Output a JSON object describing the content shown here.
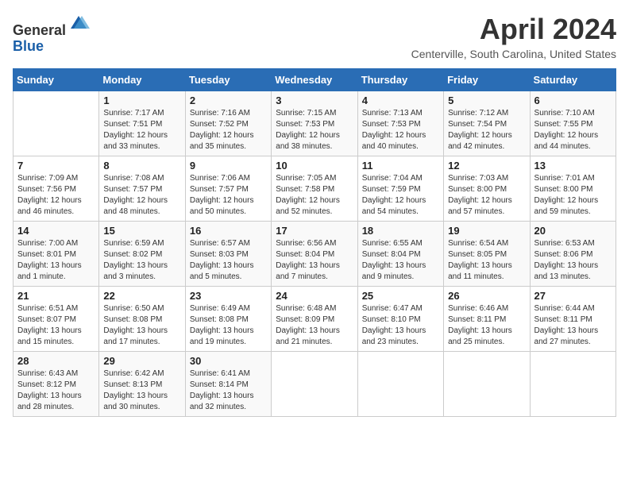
{
  "header": {
    "logo_line1": "General",
    "logo_line2": "Blue",
    "month": "April 2024",
    "location": "Centerville, South Carolina, United States"
  },
  "days_of_week": [
    "Sunday",
    "Monday",
    "Tuesday",
    "Wednesday",
    "Thursday",
    "Friday",
    "Saturday"
  ],
  "weeks": [
    [
      {
        "num": "",
        "info": ""
      },
      {
        "num": "1",
        "info": "Sunrise: 7:17 AM\nSunset: 7:51 PM\nDaylight: 12 hours\nand 33 minutes."
      },
      {
        "num": "2",
        "info": "Sunrise: 7:16 AM\nSunset: 7:52 PM\nDaylight: 12 hours\nand 35 minutes."
      },
      {
        "num": "3",
        "info": "Sunrise: 7:15 AM\nSunset: 7:53 PM\nDaylight: 12 hours\nand 38 minutes."
      },
      {
        "num": "4",
        "info": "Sunrise: 7:13 AM\nSunset: 7:53 PM\nDaylight: 12 hours\nand 40 minutes."
      },
      {
        "num": "5",
        "info": "Sunrise: 7:12 AM\nSunset: 7:54 PM\nDaylight: 12 hours\nand 42 minutes."
      },
      {
        "num": "6",
        "info": "Sunrise: 7:10 AM\nSunset: 7:55 PM\nDaylight: 12 hours\nand 44 minutes."
      }
    ],
    [
      {
        "num": "7",
        "info": "Sunrise: 7:09 AM\nSunset: 7:56 PM\nDaylight: 12 hours\nand 46 minutes."
      },
      {
        "num": "8",
        "info": "Sunrise: 7:08 AM\nSunset: 7:57 PM\nDaylight: 12 hours\nand 48 minutes."
      },
      {
        "num": "9",
        "info": "Sunrise: 7:06 AM\nSunset: 7:57 PM\nDaylight: 12 hours\nand 50 minutes."
      },
      {
        "num": "10",
        "info": "Sunrise: 7:05 AM\nSunset: 7:58 PM\nDaylight: 12 hours\nand 52 minutes."
      },
      {
        "num": "11",
        "info": "Sunrise: 7:04 AM\nSunset: 7:59 PM\nDaylight: 12 hours\nand 54 minutes."
      },
      {
        "num": "12",
        "info": "Sunrise: 7:03 AM\nSunset: 8:00 PM\nDaylight: 12 hours\nand 57 minutes."
      },
      {
        "num": "13",
        "info": "Sunrise: 7:01 AM\nSunset: 8:00 PM\nDaylight: 12 hours\nand 59 minutes."
      }
    ],
    [
      {
        "num": "14",
        "info": "Sunrise: 7:00 AM\nSunset: 8:01 PM\nDaylight: 13 hours\nand 1 minute."
      },
      {
        "num": "15",
        "info": "Sunrise: 6:59 AM\nSunset: 8:02 PM\nDaylight: 13 hours\nand 3 minutes."
      },
      {
        "num": "16",
        "info": "Sunrise: 6:57 AM\nSunset: 8:03 PM\nDaylight: 13 hours\nand 5 minutes."
      },
      {
        "num": "17",
        "info": "Sunrise: 6:56 AM\nSunset: 8:04 PM\nDaylight: 13 hours\nand 7 minutes."
      },
      {
        "num": "18",
        "info": "Sunrise: 6:55 AM\nSunset: 8:04 PM\nDaylight: 13 hours\nand 9 minutes."
      },
      {
        "num": "19",
        "info": "Sunrise: 6:54 AM\nSunset: 8:05 PM\nDaylight: 13 hours\nand 11 minutes."
      },
      {
        "num": "20",
        "info": "Sunrise: 6:53 AM\nSunset: 8:06 PM\nDaylight: 13 hours\nand 13 minutes."
      }
    ],
    [
      {
        "num": "21",
        "info": "Sunrise: 6:51 AM\nSunset: 8:07 PM\nDaylight: 13 hours\nand 15 minutes."
      },
      {
        "num": "22",
        "info": "Sunrise: 6:50 AM\nSunset: 8:08 PM\nDaylight: 13 hours\nand 17 minutes."
      },
      {
        "num": "23",
        "info": "Sunrise: 6:49 AM\nSunset: 8:08 PM\nDaylight: 13 hours\nand 19 minutes."
      },
      {
        "num": "24",
        "info": "Sunrise: 6:48 AM\nSunset: 8:09 PM\nDaylight: 13 hours\nand 21 minutes."
      },
      {
        "num": "25",
        "info": "Sunrise: 6:47 AM\nSunset: 8:10 PM\nDaylight: 13 hours\nand 23 minutes."
      },
      {
        "num": "26",
        "info": "Sunrise: 6:46 AM\nSunset: 8:11 PM\nDaylight: 13 hours\nand 25 minutes."
      },
      {
        "num": "27",
        "info": "Sunrise: 6:44 AM\nSunset: 8:11 PM\nDaylight: 13 hours\nand 27 minutes."
      }
    ],
    [
      {
        "num": "28",
        "info": "Sunrise: 6:43 AM\nSunset: 8:12 PM\nDaylight: 13 hours\nand 28 minutes."
      },
      {
        "num": "29",
        "info": "Sunrise: 6:42 AM\nSunset: 8:13 PM\nDaylight: 13 hours\nand 30 minutes."
      },
      {
        "num": "30",
        "info": "Sunrise: 6:41 AM\nSunset: 8:14 PM\nDaylight: 13 hours\nand 32 minutes."
      },
      {
        "num": "",
        "info": ""
      },
      {
        "num": "",
        "info": ""
      },
      {
        "num": "",
        "info": ""
      },
      {
        "num": "",
        "info": ""
      }
    ]
  ]
}
